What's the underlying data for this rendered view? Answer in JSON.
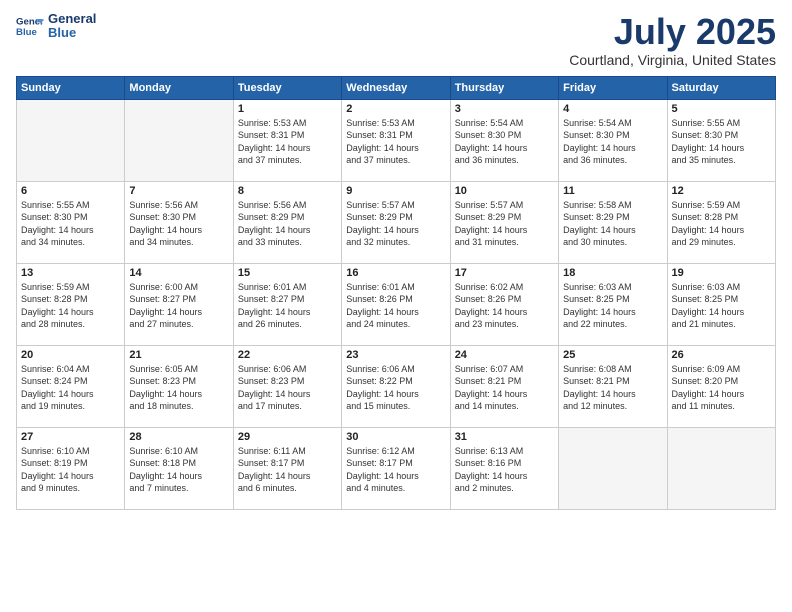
{
  "logo": {
    "line1": "General",
    "line2": "Blue"
  },
  "title": "July 2025",
  "location": "Courtland, Virginia, United States",
  "weekdays": [
    "Sunday",
    "Monday",
    "Tuesday",
    "Wednesday",
    "Thursday",
    "Friday",
    "Saturday"
  ],
  "weeks": [
    [
      {
        "day": "",
        "info": ""
      },
      {
        "day": "",
        "info": ""
      },
      {
        "day": "1",
        "info": "Sunrise: 5:53 AM\nSunset: 8:31 PM\nDaylight: 14 hours\nand 37 minutes."
      },
      {
        "day": "2",
        "info": "Sunrise: 5:53 AM\nSunset: 8:31 PM\nDaylight: 14 hours\nand 37 minutes."
      },
      {
        "day": "3",
        "info": "Sunrise: 5:54 AM\nSunset: 8:30 PM\nDaylight: 14 hours\nand 36 minutes."
      },
      {
        "day": "4",
        "info": "Sunrise: 5:54 AM\nSunset: 8:30 PM\nDaylight: 14 hours\nand 36 minutes."
      },
      {
        "day": "5",
        "info": "Sunrise: 5:55 AM\nSunset: 8:30 PM\nDaylight: 14 hours\nand 35 minutes."
      }
    ],
    [
      {
        "day": "6",
        "info": "Sunrise: 5:55 AM\nSunset: 8:30 PM\nDaylight: 14 hours\nand 34 minutes."
      },
      {
        "day": "7",
        "info": "Sunrise: 5:56 AM\nSunset: 8:30 PM\nDaylight: 14 hours\nand 34 minutes."
      },
      {
        "day": "8",
        "info": "Sunrise: 5:56 AM\nSunset: 8:29 PM\nDaylight: 14 hours\nand 33 minutes."
      },
      {
        "day": "9",
        "info": "Sunrise: 5:57 AM\nSunset: 8:29 PM\nDaylight: 14 hours\nand 32 minutes."
      },
      {
        "day": "10",
        "info": "Sunrise: 5:57 AM\nSunset: 8:29 PM\nDaylight: 14 hours\nand 31 minutes."
      },
      {
        "day": "11",
        "info": "Sunrise: 5:58 AM\nSunset: 8:29 PM\nDaylight: 14 hours\nand 30 minutes."
      },
      {
        "day": "12",
        "info": "Sunrise: 5:59 AM\nSunset: 8:28 PM\nDaylight: 14 hours\nand 29 minutes."
      }
    ],
    [
      {
        "day": "13",
        "info": "Sunrise: 5:59 AM\nSunset: 8:28 PM\nDaylight: 14 hours\nand 28 minutes."
      },
      {
        "day": "14",
        "info": "Sunrise: 6:00 AM\nSunset: 8:27 PM\nDaylight: 14 hours\nand 27 minutes."
      },
      {
        "day": "15",
        "info": "Sunrise: 6:01 AM\nSunset: 8:27 PM\nDaylight: 14 hours\nand 26 minutes."
      },
      {
        "day": "16",
        "info": "Sunrise: 6:01 AM\nSunset: 8:26 PM\nDaylight: 14 hours\nand 24 minutes."
      },
      {
        "day": "17",
        "info": "Sunrise: 6:02 AM\nSunset: 8:26 PM\nDaylight: 14 hours\nand 23 minutes."
      },
      {
        "day": "18",
        "info": "Sunrise: 6:03 AM\nSunset: 8:25 PM\nDaylight: 14 hours\nand 22 minutes."
      },
      {
        "day": "19",
        "info": "Sunrise: 6:03 AM\nSunset: 8:25 PM\nDaylight: 14 hours\nand 21 minutes."
      }
    ],
    [
      {
        "day": "20",
        "info": "Sunrise: 6:04 AM\nSunset: 8:24 PM\nDaylight: 14 hours\nand 19 minutes."
      },
      {
        "day": "21",
        "info": "Sunrise: 6:05 AM\nSunset: 8:23 PM\nDaylight: 14 hours\nand 18 minutes."
      },
      {
        "day": "22",
        "info": "Sunrise: 6:06 AM\nSunset: 8:23 PM\nDaylight: 14 hours\nand 17 minutes."
      },
      {
        "day": "23",
        "info": "Sunrise: 6:06 AM\nSunset: 8:22 PM\nDaylight: 14 hours\nand 15 minutes."
      },
      {
        "day": "24",
        "info": "Sunrise: 6:07 AM\nSunset: 8:21 PM\nDaylight: 14 hours\nand 14 minutes."
      },
      {
        "day": "25",
        "info": "Sunrise: 6:08 AM\nSunset: 8:21 PM\nDaylight: 14 hours\nand 12 minutes."
      },
      {
        "day": "26",
        "info": "Sunrise: 6:09 AM\nSunset: 8:20 PM\nDaylight: 14 hours\nand 11 minutes."
      }
    ],
    [
      {
        "day": "27",
        "info": "Sunrise: 6:10 AM\nSunset: 8:19 PM\nDaylight: 14 hours\nand 9 minutes."
      },
      {
        "day": "28",
        "info": "Sunrise: 6:10 AM\nSunset: 8:18 PM\nDaylight: 14 hours\nand 7 minutes."
      },
      {
        "day": "29",
        "info": "Sunrise: 6:11 AM\nSunset: 8:17 PM\nDaylight: 14 hours\nand 6 minutes."
      },
      {
        "day": "30",
        "info": "Sunrise: 6:12 AM\nSunset: 8:17 PM\nDaylight: 14 hours\nand 4 minutes."
      },
      {
        "day": "31",
        "info": "Sunrise: 6:13 AM\nSunset: 8:16 PM\nDaylight: 14 hours\nand 2 minutes."
      },
      {
        "day": "",
        "info": ""
      },
      {
        "day": "",
        "info": ""
      }
    ]
  ]
}
